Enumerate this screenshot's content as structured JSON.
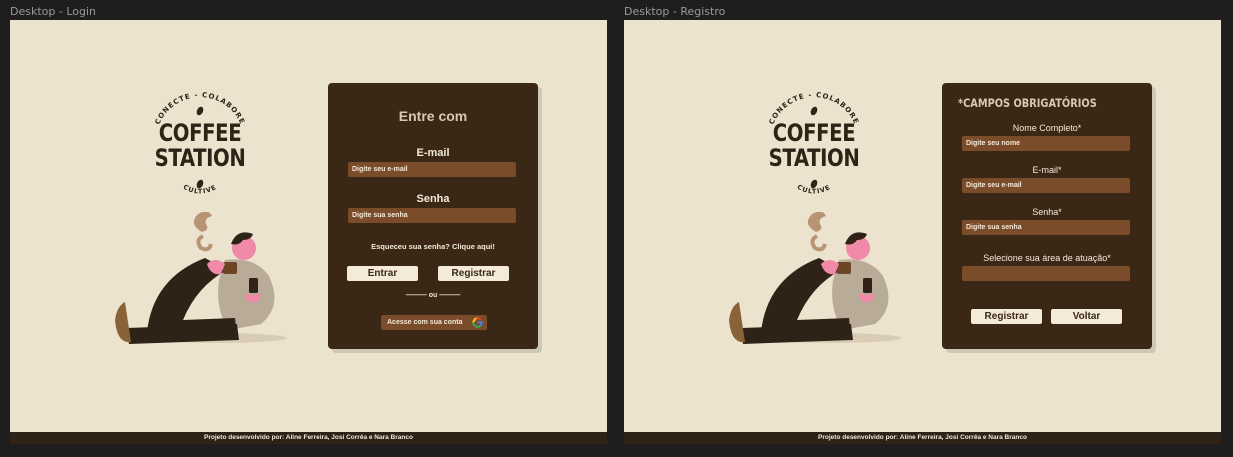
{
  "frames": {
    "login_label": "Desktop - Login",
    "register_label": "Desktop - Registro"
  },
  "logo": {
    "top_text": "CONECTE - COLABORE",
    "line1": "COFFEE",
    "line2": "STATION",
    "bottom_text": "CULTIVE"
  },
  "login": {
    "title": "Entre com",
    "email_label": "E-mail",
    "email_placeholder": "Digite seu e-mail",
    "password_label": "Senha",
    "password_placeholder": "Digite sua senha",
    "forgot": "Esqueceu sua senha? Clique aqui!",
    "enter_button": "Entrar",
    "register_button": "Registrar",
    "divider": "——— ou ———",
    "google_button": "Acesse com sua conta"
  },
  "register": {
    "title": "*CAMPOS OBRIGATÓRIOS",
    "name_label": "Nome Completo*",
    "name_placeholder": "Digite seu nome",
    "email_label": "E-mail*",
    "email_placeholder": "Digite seu e-mail",
    "password_label": "Senha*",
    "password_placeholder": "Digite sua senha",
    "area_label": "Selecione sua área de atuação*",
    "area_value": "",
    "register_button": "Registrar",
    "back_button": "Voltar"
  },
  "footer": {
    "text": "Projeto desenvolvido por: Aline Ferreira, Josi Corrêa e Nara Branco"
  },
  "colors": {
    "background": "#ece3cf",
    "panel": "#3a2716",
    "input": "#7a4c2a",
    "button": "#f3ead8"
  }
}
